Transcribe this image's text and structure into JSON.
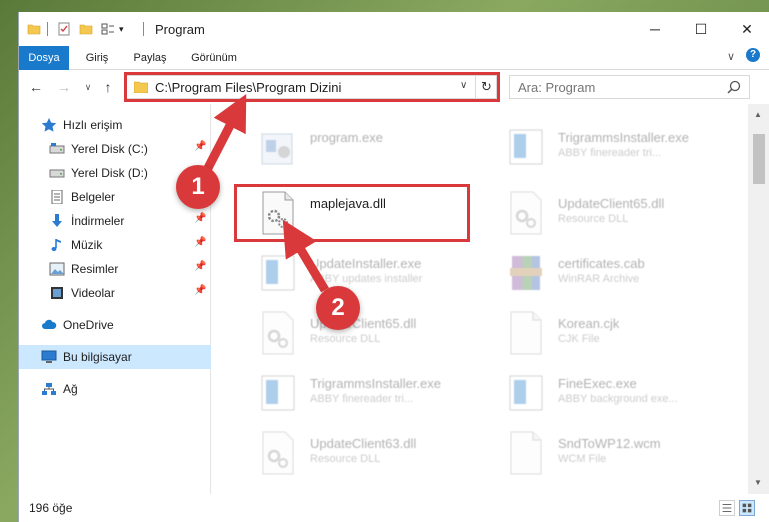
{
  "titlebar": {
    "title": "Program",
    "minimize": "─",
    "maximize": "☐",
    "close": "✕"
  },
  "ribbon": {
    "tabs": [
      "Dosya",
      "Giriş",
      "Paylaş",
      "Görünüm"
    ],
    "collapse": "∨",
    "help": "?"
  },
  "address": {
    "path": "C:\\Program Files\\Program Dizini",
    "dropdown": "∨",
    "refresh": "↻"
  },
  "search": {
    "placeholder": "Ara: Program"
  },
  "nav": {
    "back": "←",
    "forward": "→",
    "recent": "∨",
    "up": "↑",
    "items": [
      {
        "label": "Hızlı erişim",
        "icon": "star-icon",
        "pinned": false
      },
      {
        "label": "Yerel Disk (C:)",
        "icon": "drive-icon",
        "pinned": true
      },
      {
        "label": "Yerel Disk (D:)",
        "icon": "drive-icon",
        "pinned": false
      },
      {
        "label": "Belgeler",
        "icon": "documents-icon",
        "pinned": true
      },
      {
        "label": "İndirmeler",
        "icon": "download-icon",
        "pinned": true
      },
      {
        "label": "Müzik",
        "icon": "music-icon",
        "pinned": true
      },
      {
        "label": "Resimler",
        "icon": "pictures-icon",
        "pinned": true
      },
      {
        "label": "Videolar",
        "icon": "videos-icon",
        "pinned": true
      },
      {
        "label": "OneDrive",
        "icon": "cloud-icon",
        "pinned": false
      },
      {
        "label": "Bu bilgisayar",
        "icon": "computer-icon",
        "pinned": false
      },
      {
        "label": "Ağ",
        "icon": "network-icon",
        "pinned": false
      }
    ],
    "pin_glyph": "📌"
  },
  "files": [
    {
      "name": "program.exe",
      "desc": "",
      "icon": "exe-icon"
    },
    {
      "name": "TrigrammsInstaller.exe",
      "desc": "ABBY finereader tri...",
      "icon": "installer-icon"
    },
    {
      "name": "maplejava.dll",
      "desc": "",
      "icon": "dll-icon"
    },
    {
      "name": "UpdateClient65.dll",
      "desc": "Resource DLL",
      "icon": "dll-icon"
    },
    {
      "name": "UpdateInstaller.exe",
      "desc": "ABBY updates installer",
      "icon": "installer-icon"
    },
    {
      "name": "certificates.cab",
      "desc": "WinRAR Archive",
      "icon": "archive-icon"
    },
    {
      "name": "UpdateClient65.dll",
      "desc": "Resource DLL",
      "icon": "dll-icon"
    },
    {
      "name": "Korean.cjk",
      "desc": "CJK File",
      "icon": "file-icon"
    },
    {
      "name": "TrigrammsInstaller.exe",
      "desc": "ABBY finereader tri...",
      "icon": "installer-icon"
    },
    {
      "name": "FineExec.exe",
      "desc": "ABBY background exe...",
      "icon": "installer-icon"
    },
    {
      "name": "UpdateClient63.dll",
      "desc": "Resource DLL",
      "icon": "dll-icon"
    },
    {
      "name": "SndToWP12.wcm",
      "desc": "WCM File",
      "icon": "file-icon"
    }
  ],
  "status": {
    "count": "196 öğe"
  },
  "callouts": {
    "one": "1",
    "two": "2"
  },
  "colors": {
    "accent": "#1979ca",
    "highlight": "#d9393a",
    "selected": "#cce8ff"
  }
}
